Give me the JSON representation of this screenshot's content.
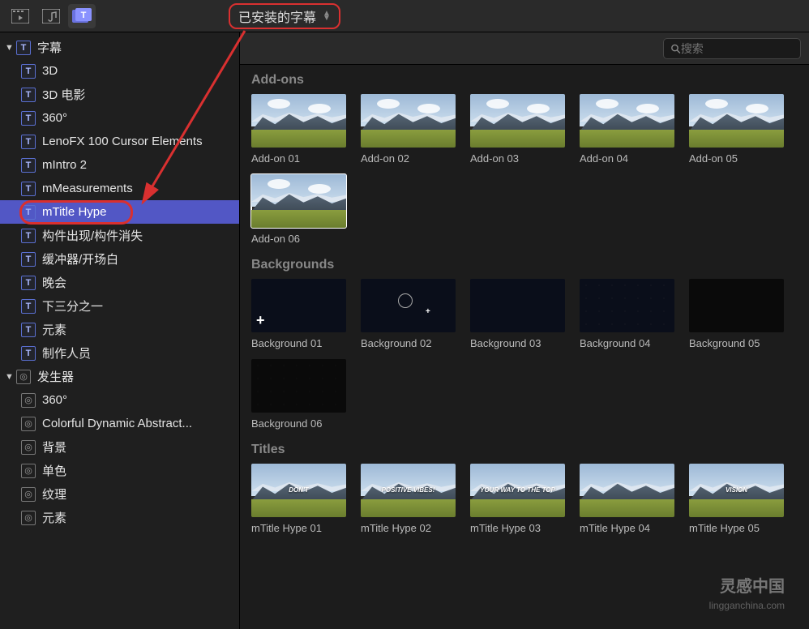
{
  "toolbar": {
    "dropdown_label": "已安装的字幕"
  },
  "search": {
    "placeholder": "搜索"
  },
  "sidebar": {
    "groups": [
      {
        "label": "字幕",
        "icon": "T",
        "children": [
          {
            "label": "3D",
            "icon": "T"
          },
          {
            "label": "3D 电影",
            "icon": "T"
          },
          {
            "label": "360°",
            "icon": "T"
          },
          {
            "label": "LenoFX 100 Cursor Elements",
            "icon": "T"
          },
          {
            "label": "mIntro 2",
            "icon": "T"
          },
          {
            "label": "mMeasurements",
            "icon": "T"
          },
          {
            "label": "mTitle Hype",
            "icon": "T",
            "selected": true
          },
          {
            "label": "构件出现/构件消失",
            "icon": "T"
          },
          {
            "label": "缓冲器/开场白",
            "icon": "T"
          },
          {
            "label": "晚会",
            "icon": "T"
          },
          {
            "label": "下三分之一",
            "icon": "T"
          },
          {
            "label": "元素",
            "icon": "T"
          },
          {
            "label": "制作人员",
            "icon": "T"
          }
        ]
      },
      {
        "label": "发生器",
        "icon": "G",
        "children": [
          {
            "label": "360°",
            "icon": "G"
          },
          {
            "label": "Colorful Dynamic Abstract...",
            "icon": "G"
          },
          {
            "label": "背景",
            "icon": "G"
          },
          {
            "label": "单色",
            "icon": "G"
          },
          {
            "label": "纹理",
            "icon": "G"
          },
          {
            "label": "元素",
            "icon": "G"
          }
        ]
      }
    ]
  },
  "sections": {
    "addons": {
      "title": "Add-ons",
      "items": [
        {
          "label": "Add-on 01"
        },
        {
          "label": "Add-on 02"
        },
        {
          "label": "Add-on 03"
        },
        {
          "label": "Add-on 04"
        },
        {
          "label": "Add-on 05"
        },
        {
          "label": "Add-on 06",
          "selected": true
        }
      ]
    },
    "backgrounds": {
      "title": "Backgrounds",
      "items": [
        {
          "label": "Background 01"
        },
        {
          "label": "Background 02"
        },
        {
          "label": "Background 03"
        },
        {
          "label": "Background 04"
        },
        {
          "label": "Background 05"
        },
        {
          "label": "Background 06"
        }
      ]
    },
    "titles": {
      "title": "Titles",
      "items": [
        {
          "label": "mTitle Hype 01",
          "overlay": "DON'T"
        },
        {
          "label": "mTitle Hype 02",
          "overlay": "POSITIVE VIBES!"
        },
        {
          "label": "mTitle Hype 03",
          "overlay": "YOUR WAY TO THE TOP"
        },
        {
          "label": "mTitle Hype 04",
          "overlay": ""
        },
        {
          "label": "mTitle Hype 05",
          "overlay": "VISION"
        }
      ]
    }
  },
  "watermark": {
    "main": "灵感中国",
    "sub": "lingganchina.com"
  }
}
